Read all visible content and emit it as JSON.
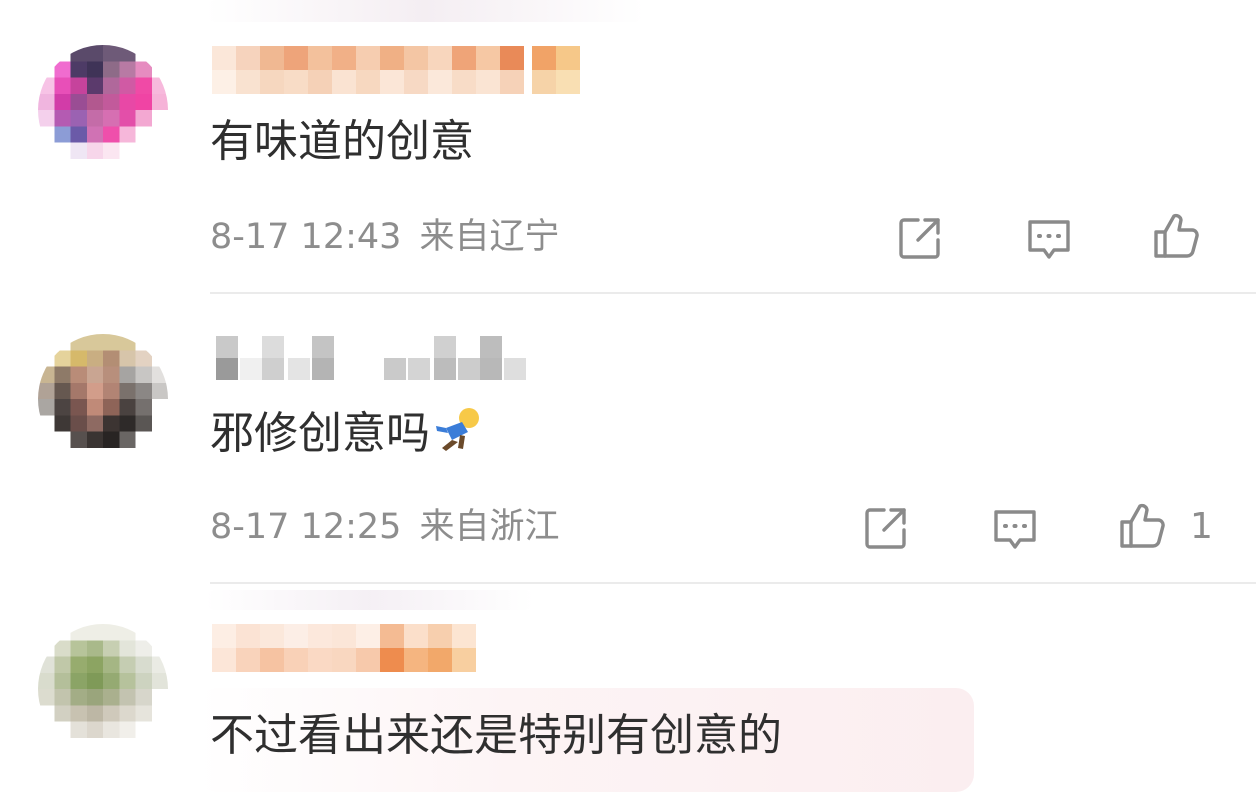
{
  "comments": [
    {
      "text": "有味道的创意",
      "time": "8-17 12:43",
      "location": "来自辽宁",
      "like_count": ""
    },
    {
      "text": "邪修创意吗",
      "emoji": "person-falling-emoji",
      "time": "8-17 12:25",
      "location": "来自浙江",
      "like_count": "1"
    },
    {
      "text": "不过看出来还是特别有创意的"
    }
  ],
  "icons": {
    "share": "share-icon",
    "comment": "comment-icon",
    "like": "thumbs-up-icon"
  },
  "colors": {
    "text": "#2f2f2f",
    "meta": "#8d8d8d",
    "divider": "#ebebeb",
    "icon": "#8a8a8a"
  }
}
